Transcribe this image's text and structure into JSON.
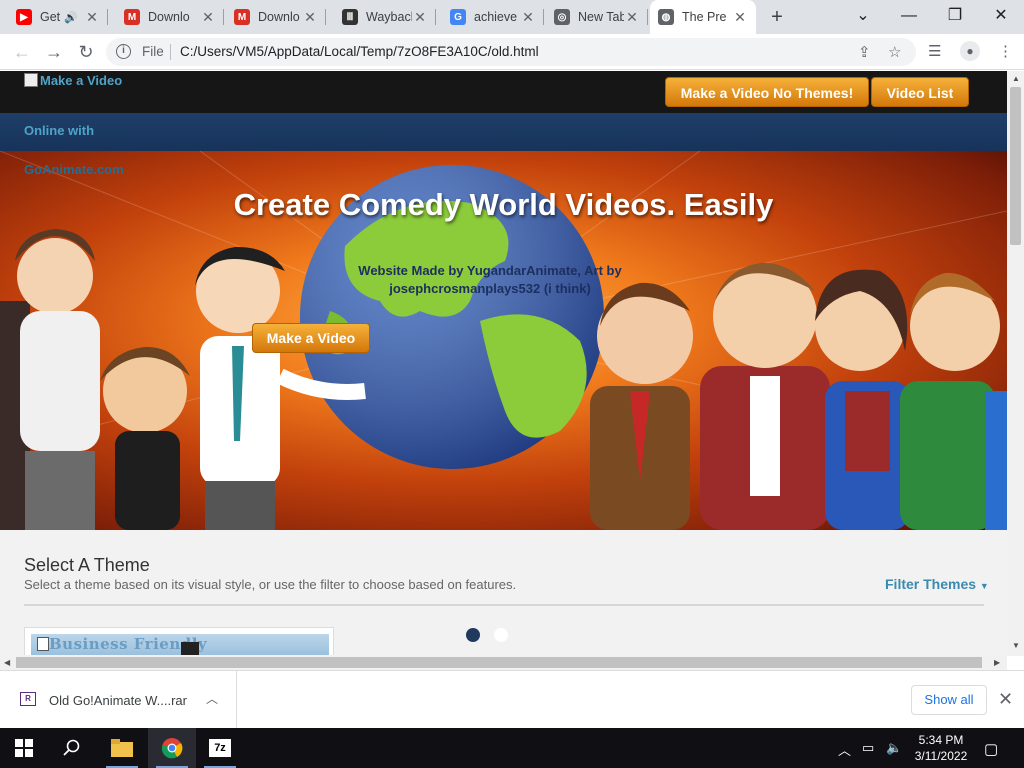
{
  "browser": {
    "tabs": [
      {
        "title": "Get",
        "favicon": "youtube-icon",
        "color": "#ff0000",
        "glyph": "▶",
        "audio": true
      },
      {
        "title": "Downlo",
        "favicon": "gmail-icon",
        "color": "#d93025",
        "glyph": "M"
      },
      {
        "title": "Downlo",
        "favicon": "gmail-icon",
        "color": "#d93025",
        "glyph": "M"
      },
      {
        "title": "Wayback",
        "favicon": "archive-icon",
        "color": "#333333",
        "glyph": "Ⅲ"
      },
      {
        "title": "achieve",
        "favicon": "google-icon",
        "color": "#4285f4",
        "glyph": "G"
      },
      {
        "title": "New Tab",
        "favicon": "chrome-icon",
        "color": "#5f6368",
        "glyph": "◎"
      },
      {
        "title": "The Pre",
        "favicon": "globe-icon",
        "color": "#5f6368",
        "glyph": "◍",
        "active": true
      }
    ],
    "address": {
      "scheme": "File",
      "url": "C:/Users/VM5/AppData/Local/Temp/7zO8FE3A10C/old.html"
    }
  },
  "page": {
    "header": {
      "logo_alt": "Make a Video",
      "btn_no_themes": "Make a Video No Themes!",
      "btn_video_list": "Video List"
    },
    "subnav_text": "Online with",
    "hero": {
      "bg_text": "GoAnimate.com",
      "title": "Create Comedy World Videos. Easily",
      "credit": "Website Made by YugandarAnimate, Art by josephcrosmanplays532 (i think)",
      "cta": "Make a Video"
    },
    "themes": {
      "title": "Select A Theme",
      "description": "Select a theme based on its visual style, or use the filter to choose based on features.",
      "filter_label": "Filter Themes",
      "first_card_label": "Business Friendly",
      "pager": {
        "pages": 2,
        "current": 1
      }
    }
  },
  "downloads": {
    "file_name": "Old Go!Animate W....rar",
    "show_all": "Show all"
  },
  "taskbar": {
    "time": "5:34 PM",
    "date": "3/11/2022"
  },
  "colors": {
    "accent_orange": "#e58a12",
    "nav_dark": "#161616",
    "subnav_blue": "#1e3f68",
    "link_blue": "#3b8ab0"
  }
}
